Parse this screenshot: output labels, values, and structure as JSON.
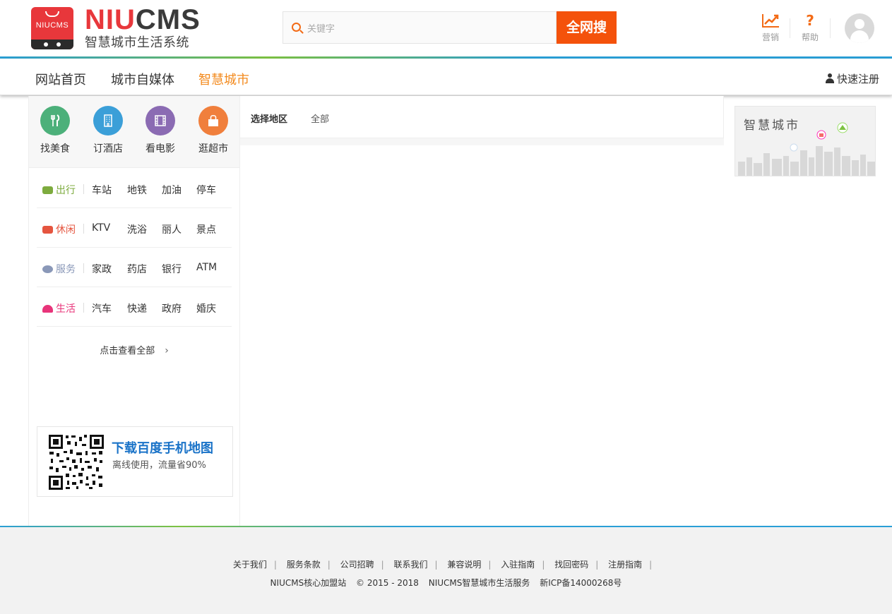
{
  "header": {
    "logo_box_text": "NIUCMS",
    "logo_name_a": "NIU",
    "logo_name_b": "CMS",
    "logo_sub": "智慧城市生活系统",
    "search_placeholder": "关键字",
    "search_button": "全网搜",
    "marketing_label": "营销",
    "help_label": "帮助",
    "help_glyph": "?"
  },
  "nav": {
    "items": [
      "网站首页",
      "城市自媒体",
      "智慧城市"
    ],
    "active_index": 2,
    "register": "快速注册"
  },
  "quick": [
    {
      "label": "找美食",
      "color": "#4cb07a",
      "icon": "food-icon"
    },
    {
      "label": "订酒店",
      "color": "#3b9fd8",
      "icon": "hotel-icon"
    },
    {
      "label": "看电影",
      "color": "#8b6bb3",
      "icon": "film-icon"
    },
    {
      "label": "逛超市",
      "color": "#f07f3c",
      "icon": "shopping-bag-icon"
    }
  ],
  "categories": [
    {
      "name": "出行",
      "color": "#7dab3e",
      "icon": "car-icon",
      "links": [
        "车站",
        "地铁",
        "加油",
        "停车"
      ]
    },
    {
      "name": "休闲",
      "color": "#e5553f",
      "icon": "cup-icon",
      "links": [
        "KTV",
        "洗浴",
        "丽人",
        "景点"
      ]
    },
    {
      "name": "服务",
      "color": "#8a98b8",
      "icon": "heart-icon",
      "links": [
        "家政",
        "药店",
        "银行",
        "ATM"
      ]
    },
    {
      "name": "生活",
      "color": "#e8347a",
      "icon": "dashboard-icon",
      "links": [
        "汽车",
        "快递",
        "政府",
        "婚庆"
      ]
    }
  ],
  "view_all": "点击查看全部",
  "view_all_chevron": "›",
  "qr": {
    "title": "下载百度手机地图",
    "subtitle": "离线使用，流量省90%"
  },
  "filter": {
    "label": "选择地区",
    "value": "全部"
  },
  "ad": {
    "title": "智慧城市"
  },
  "footer": {
    "links": [
      "关于我们",
      "服务条款",
      "公司招聘",
      "联系我们",
      "兼容说明",
      "入驻指南",
      "找回密码",
      "注册指南"
    ],
    "separator": "|",
    "site": "NIUCMS核心加盟站",
    "copyright": "© 2015 - 2018",
    "company": "NIUCMS智慧城市生活服务",
    "icp": "新ICP备14000268号"
  }
}
